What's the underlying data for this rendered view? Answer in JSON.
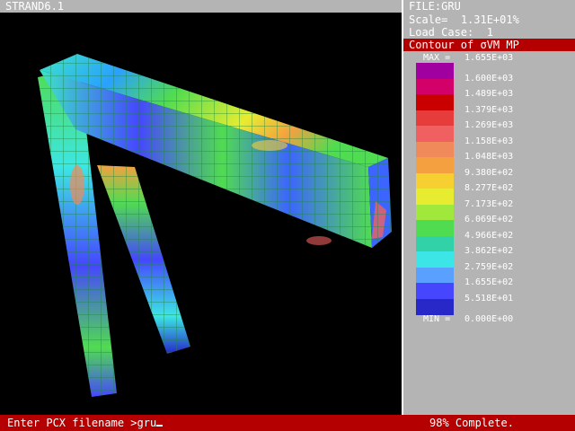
{
  "window": {
    "title": "STRAND6.1"
  },
  "panel": {
    "file_label": "FILE:GRU",
    "scale_label": "Scale=",
    "scale_value": "1.31E+01%",
    "load_case_label": "Load Case:",
    "load_case_value": "1",
    "contour_title": "Contour of σVM MP"
  },
  "legend": {
    "max_tag": "MAX =",
    "max_value": "1.655E+03",
    "min_tag": "MIN =",
    "min_value": "0.000E+00",
    "labels": [
      "1.600E+03",
      "1.489E+03",
      "1.379E+03",
      "1.269E+03",
      "1.158E+03",
      "1.048E+03",
      "9.380E+02",
      "8.277E+02",
      "7.173E+02",
      "6.069E+02",
      "4.966E+02",
      "3.862E+02",
      "2.759E+02",
      "1.655E+02",
      "5.518E+01"
    ],
    "colors": [
      "#a000a0",
      "#d4006a",
      "#c80000",
      "#e63c3c",
      "#f06060",
      "#f08a5a",
      "#f4a040",
      "#f6d030",
      "#e8ec30",
      "#a0e83c",
      "#50dc50",
      "#32d2a8",
      "#3ce6e6",
      "#5aa0ff",
      "#4646ff",
      "#2828c8"
    ]
  },
  "status": {
    "prompt": "Enter PCX filename >gru",
    "progress": "98% Complete."
  }
}
